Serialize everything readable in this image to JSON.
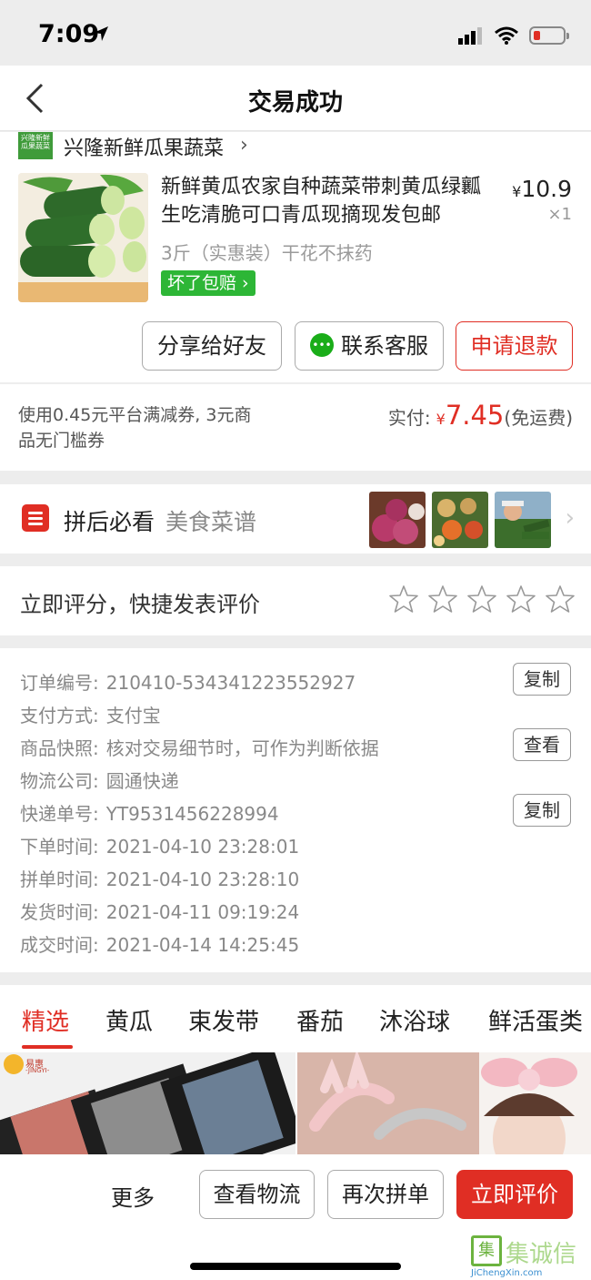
{
  "status_bar": {
    "time": "7:09"
  },
  "nav": {
    "title": "交易成功"
  },
  "store": {
    "name": "兴隆新鲜瓜果蔬菜",
    "logo_text": "兴隆新鲜瓜果蔬菜"
  },
  "product": {
    "title": "新鲜黄瓜农家自种蔬菜带刺黄瓜绿瓤生吃清脆可口青瓜现摘现发包邮",
    "currency": "¥",
    "price": "10.9",
    "quantity": "×1",
    "spec": "3斤（实惠装）干花不抹药",
    "badge": "坏了包赔"
  },
  "actions": {
    "share": "分享给好友",
    "service": "联系客服",
    "refund": "申请退款"
  },
  "payment": {
    "coupon_text": "使用0.45元平台满减券, 3元商品无门槛券",
    "paid_label": "实付:",
    "currency": "¥",
    "paid_amount": "7.45",
    "shipping": "(免运费)"
  },
  "banner": {
    "title": "拼后必看",
    "subtitle": "美食菜谱"
  },
  "rating": {
    "label": "立即评分，快捷发表评价",
    "stars_total": 5,
    "stars_selected": 0
  },
  "details": {
    "rows": [
      {
        "label": "订单编号:",
        "value": "210410-534341223552927"
      },
      {
        "label": "支付方式:",
        "value": "支付宝"
      },
      {
        "label": "商品快照:",
        "value": "核对交易细节时，可作为判断依据"
      },
      {
        "label": "物流公司:",
        "value": "圆通快递"
      },
      {
        "label": "快递单号:",
        "value": "YT9531456228994"
      },
      {
        "label": "下单时间:",
        "value": "2021-04-10 23:28:01"
      },
      {
        "label": "拼单时间:",
        "value": "2021-04-10 23:28:10"
      },
      {
        "label": "发货时间:",
        "value": "2021-04-11 09:19:24"
      },
      {
        "label": "成交时间:",
        "value": "2021-04-14 14:25:45"
      }
    ],
    "copy_label": "复制",
    "view_label": "查看"
  },
  "tabs": [
    "精选",
    "黄瓜",
    "束发带",
    "番茄",
    "沐浴球",
    "鲜活蛋类"
  ],
  "feed": {
    "brand_text": "易惠",
    "brand_sub": "-JINGYI-"
  },
  "bottom": {
    "more": "更多",
    "logistics": "查看物流",
    "reorder": "再次拼单",
    "review": "立即评价"
  },
  "watermark": {
    "text": "集诚信",
    "url": "JiChengXin.com"
  },
  "colors": {
    "accent": "#e02e24",
    "green_badge": "#2db636",
    "wechat": "#1aad19"
  }
}
